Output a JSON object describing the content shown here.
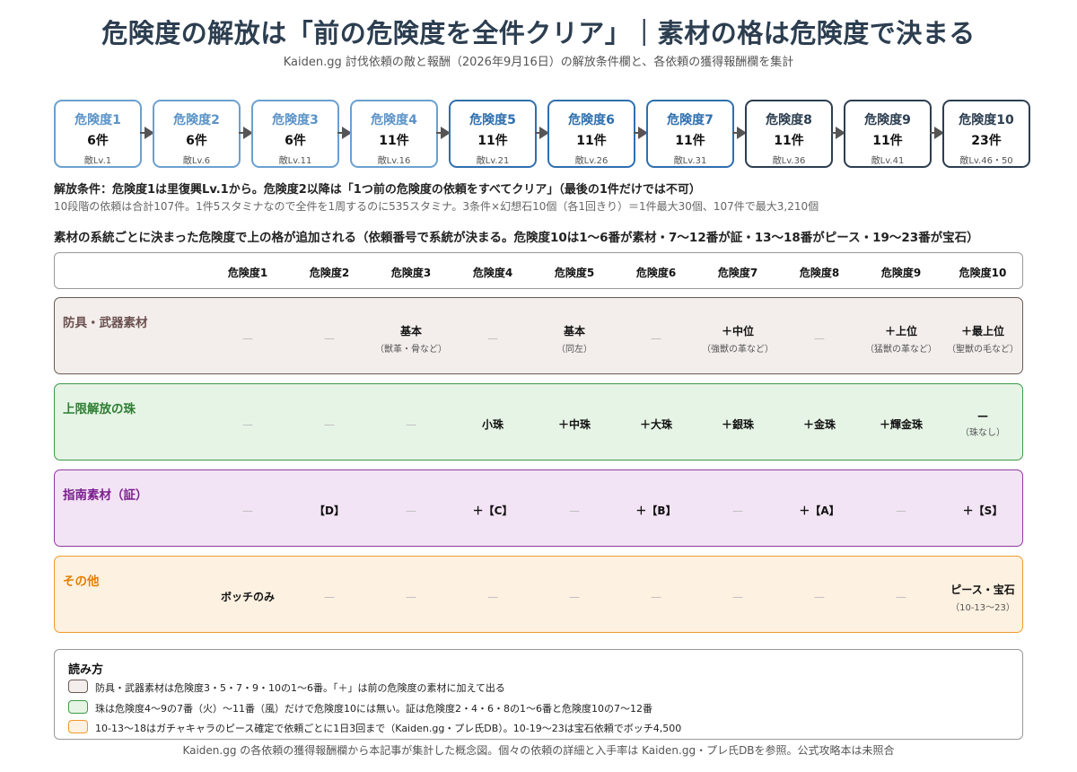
{
  "title": "危険度の解放は「前の危険度を全件クリア」｜素材の格は危険度で決まる",
  "subtitle": "Kaiden.gg 討伐依頼の敵と報酬（2026年9月16日）の解放条件欄と、各依頼の獲得報酬欄を集計",
  "tiers": [
    {
      "name": "危険度1",
      "count": "6件",
      "lv": "敵Lv.1",
      "style": "low"
    },
    {
      "name": "危険度2",
      "count": "6件",
      "lv": "敵Lv.6",
      "style": "low"
    },
    {
      "name": "危険度3",
      "count": "6件",
      "lv": "敵Lv.11",
      "style": "low"
    },
    {
      "name": "危険度4",
      "count": "11件",
      "lv": "敵Lv.16",
      "style": "low"
    },
    {
      "name": "危険度5",
      "count": "11件",
      "lv": "敵Lv.21",
      "style": "mid"
    },
    {
      "name": "危険度6",
      "count": "11件",
      "lv": "敵Lv.26",
      "style": "mid"
    },
    {
      "name": "危険度7",
      "count": "11件",
      "lv": "敵Lv.31",
      "style": "mid"
    },
    {
      "name": "危険度8",
      "count": "11件",
      "lv": "敵Lv.36",
      "style": "high"
    },
    {
      "name": "危険度9",
      "count": "11件",
      "lv": "敵Lv.41",
      "style": "high"
    },
    {
      "name": "危険度10",
      "count": "23件",
      "lv": "敵Lv.46・50",
      "style": "high"
    }
  ],
  "conditions": {
    "main": "解放条件：危険度1は里復興Lv.1から。危険度2以降は「1つ前の危険度の依頼をすべてクリア」（最後の1件だけでは不可）",
    "sub": "10段階の依頼は合計107件。1件5スタミナなので全件を1周するのに535スタミナ。3条件×幻想石10個（各1回きり）＝1件最大30個、107件で最大3,210個"
  },
  "section_heading": "素材の系統ごとに決まった危険度で上の格が追加される（依頼番号で系統が決まる。危険度10は1〜6番が素材・7〜12番が証・13〜18番がピース・19〜23番が宝石）",
  "columns": [
    "危険度1",
    "危険度2",
    "危険度3",
    "危険度4",
    "危険度5",
    "危険度6",
    "危険度7",
    "危険度8",
    "危険度9",
    "危険度10"
  ],
  "rows": [
    {
      "label": "防具・武器素材",
      "border": "#6b5a55",
      "bg": "#f3eeeb",
      "label_color": "#6b5050",
      "cells": [
        {
          "main": "—",
          "note": ""
        },
        {
          "main": "—",
          "note": ""
        },
        {
          "main": "基本",
          "note": "（獣革・骨など）"
        },
        {
          "main": "—",
          "note": ""
        },
        {
          "main": "基本",
          "note": "（同左）"
        },
        {
          "main": "—",
          "note": ""
        },
        {
          "main": "＋中位",
          "note": "（強獣の革など）"
        },
        {
          "main": "—",
          "note": ""
        },
        {
          "main": "＋上位",
          "note": "（猛獣の革など）"
        },
        {
          "main": "＋最上位",
          "note": "（聖獣の毛など）"
        }
      ]
    },
    {
      "label": "上限解放の珠",
      "border": "#3d9a47",
      "bg": "#e6f4e6",
      "label_color": "#2e7d32",
      "cells": [
        {
          "main": "—",
          "note": ""
        },
        {
          "main": "—",
          "note": ""
        },
        {
          "main": "—",
          "note": ""
        },
        {
          "main": "小珠",
          "note": ""
        },
        {
          "main": "＋中珠",
          "note": ""
        },
        {
          "main": "＋大珠",
          "note": ""
        },
        {
          "main": "＋銀珠",
          "note": ""
        },
        {
          "main": "＋金珠",
          "note": ""
        },
        {
          "main": "＋輝金珠",
          "note": ""
        },
        {
          "main": "—",
          "note": "（珠なし）"
        }
      ]
    },
    {
      "label": "指南素材（証）",
      "border": "#8e3a9e",
      "bg": "#f3e4f5",
      "label_color": "#7b1f8f",
      "cells": [
        {
          "main": "—",
          "note": ""
        },
        {
          "main": "【D】",
          "note": ""
        },
        {
          "main": "—",
          "note": ""
        },
        {
          "main": "＋【C】",
          "note": ""
        },
        {
          "main": "—",
          "note": ""
        },
        {
          "main": "＋【B】",
          "note": ""
        },
        {
          "main": "—",
          "note": ""
        },
        {
          "main": "＋【A】",
          "note": ""
        },
        {
          "main": "—",
          "note": ""
        },
        {
          "main": "＋【S】",
          "note": ""
        }
      ]
    },
    {
      "label": "その他",
      "border": "#ef9a2e",
      "bg": "#fdf1e1",
      "label_color": "#e57f00",
      "cells": [
        {
          "main": "ボッチのみ",
          "note": ""
        },
        {
          "main": "—",
          "note": ""
        },
        {
          "main": "—",
          "note": ""
        },
        {
          "main": "—",
          "note": ""
        },
        {
          "main": "—",
          "note": ""
        },
        {
          "main": "—",
          "note": ""
        },
        {
          "main": "—",
          "note": ""
        },
        {
          "main": "—",
          "note": ""
        },
        {
          "main": "—",
          "note": ""
        },
        {
          "main": "ピース・宝石",
          "note": "（10-13〜23）"
        }
      ]
    }
  ],
  "legend": {
    "title": "読み方",
    "items": [
      {
        "text": "防具・武器素材は危険度3・5・7・9・10の1〜6番。「＋」は前の危険度の素材に加えて出る",
        "border": "#6b5a55",
        "bg": "#f3eeeb"
      },
      {
        "text": "珠は危険度4〜9の7番（火）〜11番（風）だけで危険度10には無い。証は危険度2・4・6・8の1〜6番と危険度10の7〜12番",
        "border": "#3d9a47",
        "bg": "#e6f4e6"
      },
      {
        "text": "10-13〜18はガチャキャラのピース確定で依頼ごとに1日3回まで（Kaiden.gg・プレ氏DB）。10-19〜23は宝石依頼でボッチ4,500",
        "border": "#ef9a2e",
        "bg": "#fdf1e1"
      }
    ]
  },
  "footer": "Kaiden.gg の各依頼の獲得報酬欄から本記事が集計した概念図。個々の依頼の詳細と入手率は Kaiden.gg・プレ氏DBを参照。公式攻略本は未照合"
}
